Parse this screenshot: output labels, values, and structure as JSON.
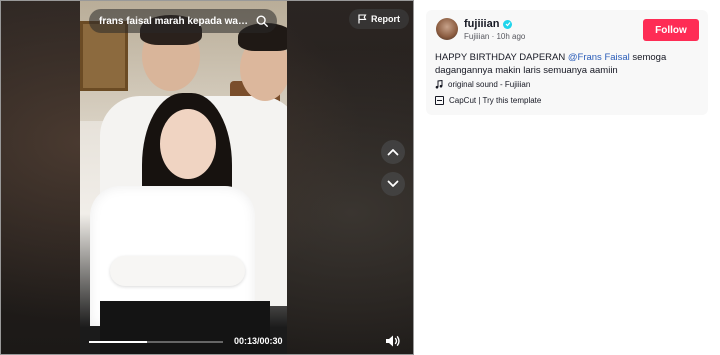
{
  "video": {
    "search_text": "frans faisal marah kepada wartaw...",
    "report_label": "Report",
    "current_time": "00:13",
    "duration": "00:30",
    "time_separator": "/",
    "progress_fraction": 0.43
  },
  "author": {
    "username": "fujiiian",
    "display_name": "Fujiiian",
    "posted_ago": "10h ago",
    "meta_separator": " · ",
    "follow_label": "Follow"
  },
  "caption": {
    "text_before": "HAPPY BIRTHDAY DAPERAN ",
    "mention": "@Frans Faisal",
    "text_after": " semoga dagangannya makin laris semuanya aamiin"
  },
  "sound": {
    "label": "original sound - Fujiiian"
  },
  "template": {
    "label": "CapCut | Try this template"
  },
  "colors": {
    "follow": "#fe2c55",
    "mention": "#2b5db9",
    "verified": "#20d5ec"
  },
  "icons": {
    "search": "search-icon",
    "report": "flag-icon",
    "up": "chevron-up-icon",
    "down": "chevron-down-icon",
    "volume": "volume-icon",
    "music": "music-note-icon",
    "capcut": "capcut-icon",
    "verified": "verified-badge-icon"
  }
}
